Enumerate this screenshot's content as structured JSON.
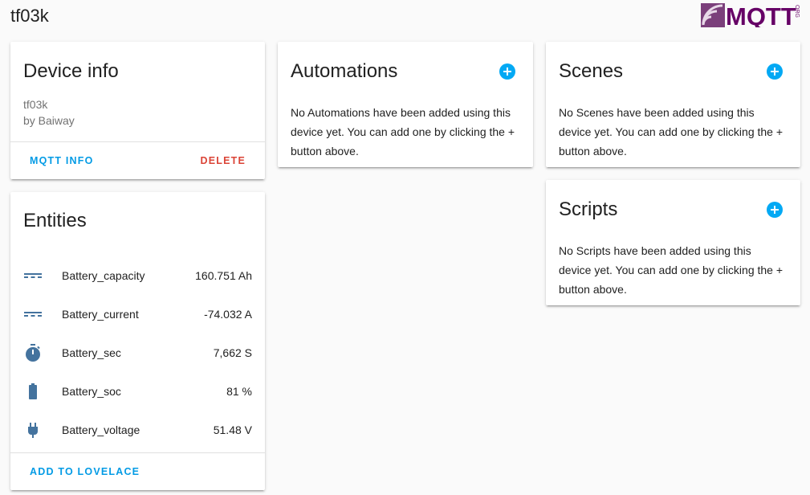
{
  "page": {
    "title": "tf03k"
  },
  "logo": {
    "text": "MQTT",
    "sub": "ORG",
    "brand_color": "#660066"
  },
  "device_info": {
    "title": "Device info",
    "model": "tf03k",
    "manufacturer": "by Baiway",
    "mqtt_info_label": "MQTT INFO",
    "delete_label": "DELETE"
  },
  "entities": {
    "title": "Entities",
    "items": [
      {
        "name": "Battery_capacity",
        "value": "160.751 Ah",
        "icon": "current-dc-icon"
      },
      {
        "name": "Battery_current",
        "value": "-74.032 A",
        "icon": "current-dc-icon"
      },
      {
        "name": "Battery_sec",
        "value": "7,662 S",
        "icon": "timer-icon"
      },
      {
        "name": "Battery_soc",
        "value": "81 %",
        "icon": "battery-icon"
      },
      {
        "name": "Battery_voltage",
        "value": "51.48 V",
        "icon": "power-plug-icon"
      }
    ],
    "add_label": "ADD TO LOVELACE"
  },
  "automations": {
    "title": "Automations",
    "text": "No Automations have been added using this device yet. You can add one by clicking the + button above."
  },
  "scenes": {
    "title": "Scenes",
    "text": "No Scenes have been added using this device yet. You can add one by clicking the + button above."
  },
  "scripts": {
    "title": "Scripts",
    "text": "No Scripts have been added using this device yet. You can add one by clicking the + button above."
  },
  "colors": {
    "accent": "#03a9f4",
    "primary_text": "#212121",
    "secondary_text": "#727272",
    "delete": "#db4437",
    "icon": "#44739e"
  }
}
